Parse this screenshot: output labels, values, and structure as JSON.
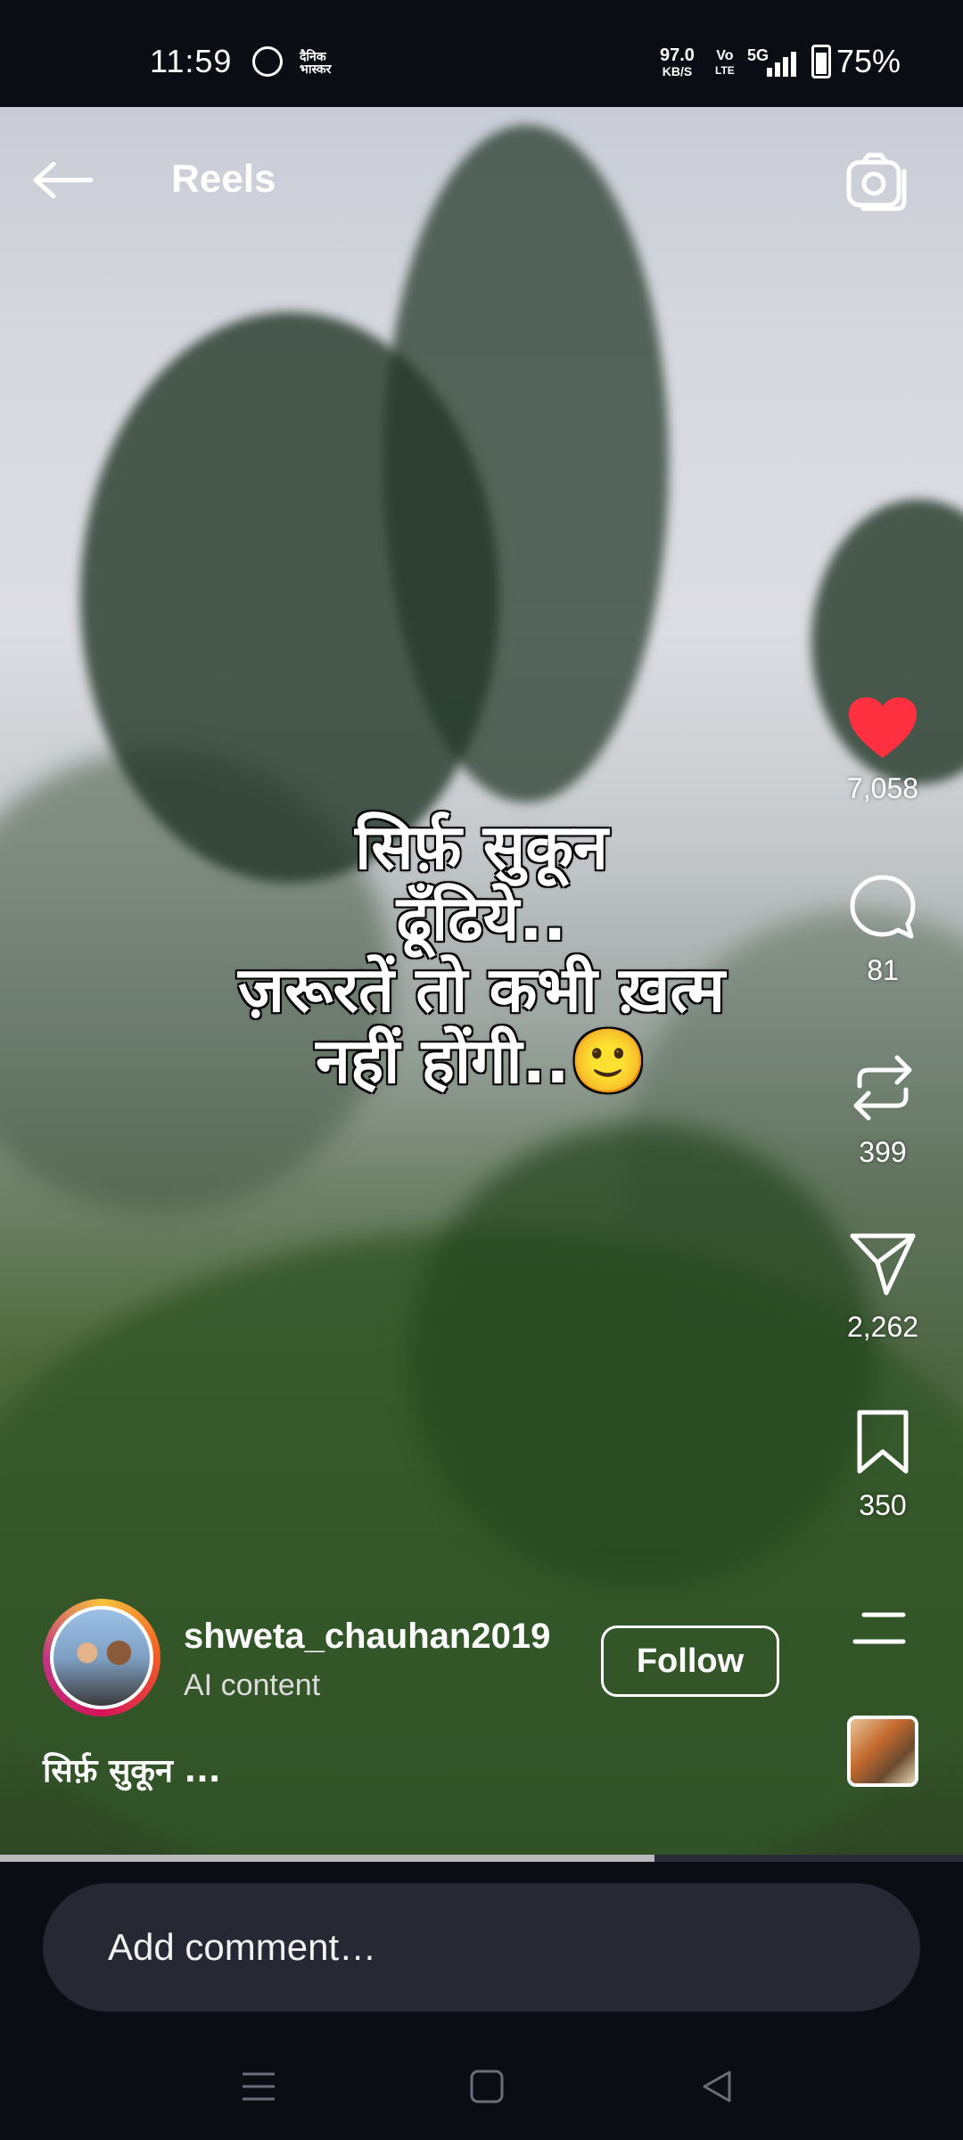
{
  "status_bar": {
    "time": "11:59",
    "news_app_label": "दैनिक भास्कर",
    "net_speed_value": "97.0",
    "net_speed_unit": "KB/S",
    "volte_top": "Vo",
    "volte_bottom": "LTE",
    "network_type": "5G",
    "battery_percent": "75%",
    "icons": [
      "whatsapp-icon",
      "dainik-bhaskar-icon",
      "signal-icon",
      "battery-icon"
    ]
  },
  "header": {
    "title": "Reels",
    "icons": [
      "back-arrow-icon",
      "camera-icon"
    ]
  },
  "overlay_text": {
    "lines": [
      "सिर्फ़ सुकून",
      "ढूँढिये..",
      "ज़रूरतें तो कभी ख़त्म",
      "नहीं होंगी..🙂"
    ]
  },
  "actions": {
    "like": {
      "icon": "heart-icon",
      "count": "7,058",
      "color": "#ff3040"
    },
    "comment": {
      "icon": "comment-icon",
      "count": "81"
    },
    "remix": {
      "icon": "repost-icon",
      "count": "399"
    },
    "share": {
      "icon": "send-icon",
      "count": "2,262"
    },
    "save": {
      "icon": "bookmark-icon",
      "count": "350"
    },
    "more": {
      "icon": "menu-lines-icon"
    },
    "audio": {
      "icon": "audio-thumbnail"
    }
  },
  "author": {
    "username": "shweta_chauhan2019",
    "sublabel": "AI content",
    "follow_label": "Follow"
  },
  "caption": {
    "text": "सिर्फ़ सुकून ..."
  },
  "progress": {
    "fraction": 0.68
  },
  "comment_bar": {
    "placeholder": "Add comment…"
  },
  "system_nav": {
    "icons": [
      "recent-apps-icon",
      "home-icon",
      "back-triangle-icon"
    ]
  }
}
